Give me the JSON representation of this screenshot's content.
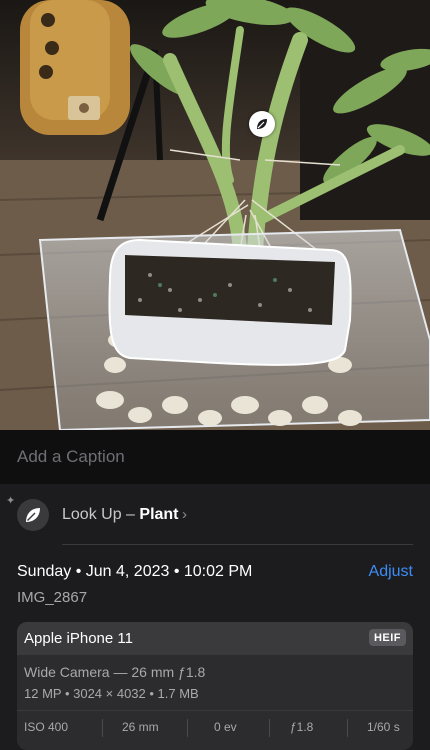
{
  "caption": {
    "placeholder": "Add a Caption"
  },
  "lookup": {
    "prefix": "Look Up – ",
    "subject": "Plant",
    "chevron": "›"
  },
  "info": {
    "date": "Sunday • Jun 4, 2023 • 10:02 PM",
    "adjust_label": "Adjust",
    "filename": "IMG_2867"
  },
  "camera": {
    "device": "Apple iPhone 11",
    "format_badge": "HEIF",
    "lens": "Wide Camera — 26 mm ƒ1.8",
    "specs": "12 MP  •  3024 × 4032  •  1.7 MB",
    "exif": {
      "iso": "ISO 400",
      "focal": "26 mm",
      "ev": "0 ev",
      "aperture": "ƒ1.8",
      "shutter": "1/60 s"
    }
  },
  "icons": {
    "visual_lookup": "leaf-icon",
    "sparkle": "sparkle-icon"
  },
  "colors": {
    "background": "#1c1c1e",
    "accent": "#3d8cf5",
    "card": "#2c2c2e"
  }
}
